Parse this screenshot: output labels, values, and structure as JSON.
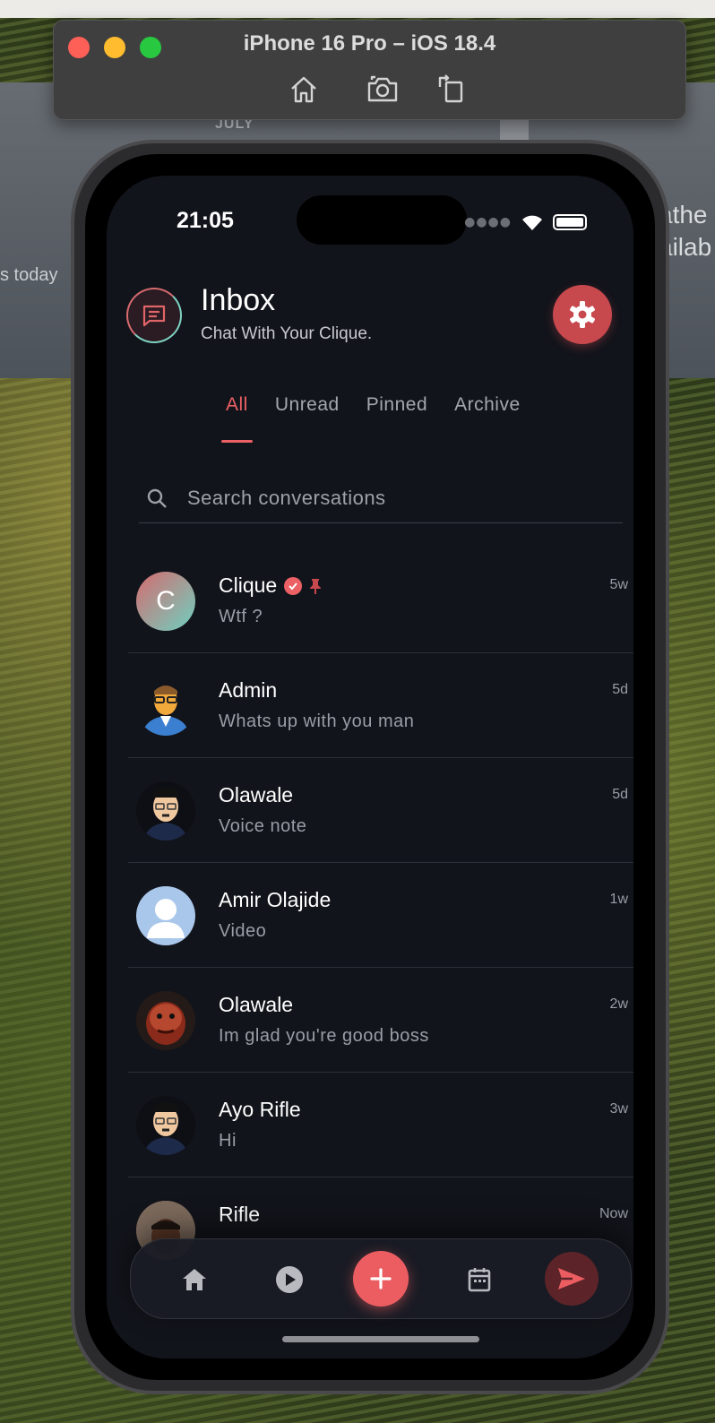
{
  "desktop": {
    "month": "JULY",
    "today_text": "s today",
    "weather_text": "athe\nailab"
  },
  "simulator": {
    "title": "iPhone 16 Pro – iOS 18.4",
    "toolbar": [
      "home-icon",
      "screenshot-icon",
      "rotate-icon"
    ]
  },
  "status_bar": {
    "time": "21:05"
  },
  "header": {
    "title": "Inbox",
    "subtitle": "Chat With Your Clique."
  },
  "tabs": [
    {
      "label": "All",
      "active": true
    },
    {
      "label": "Unread",
      "active": false
    },
    {
      "label": "Pinned",
      "active": false
    },
    {
      "label": "Archive",
      "active": false
    }
  ],
  "search": {
    "placeholder": "Search conversations"
  },
  "conversations": [
    {
      "name": "Clique",
      "preview": "Wtf ?",
      "time": "5w",
      "avatar_letter": "C",
      "verified": true,
      "pinned": true
    },
    {
      "name": "Admin",
      "preview": "Whats up with you man",
      "time": "5d"
    },
    {
      "name": "Olawale",
      "preview": "Voice note",
      "time": "5d"
    },
    {
      "name": "Amir Olajide",
      "preview": "Video",
      "time": "1w"
    },
    {
      "name": "Olawale",
      "preview": "Im glad you're good boss",
      "time": "2w"
    },
    {
      "name": "Ayo Rifle",
      "preview": "Hi",
      "time": "3w"
    },
    {
      "name": "Rifle",
      "preview": "",
      "time": "Now"
    }
  ],
  "colors": {
    "accent": "#ec6165",
    "background": "#12141b",
    "settings_button": "#c7484d"
  },
  "bottom_nav": [
    "home-icon",
    "play-icon",
    "add-icon",
    "calendar-icon",
    "send-icon"
  ]
}
